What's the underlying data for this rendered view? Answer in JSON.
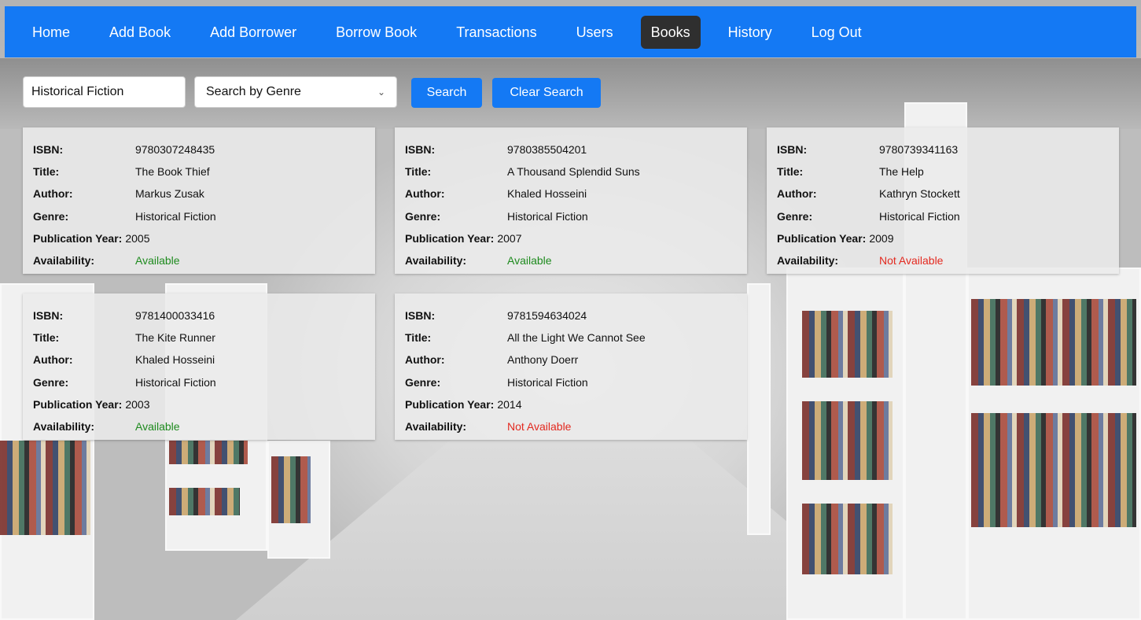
{
  "nav": {
    "items": [
      {
        "label": "Home",
        "active": false
      },
      {
        "label": "Add Book",
        "active": false
      },
      {
        "label": "Add Borrower",
        "active": false
      },
      {
        "label": "Borrow Book",
        "active": false
      },
      {
        "label": "Transactions",
        "active": false
      },
      {
        "label": "Users",
        "active": false
      },
      {
        "label": "Books",
        "active": true
      },
      {
        "label": "History",
        "active": false
      },
      {
        "label": "Log Out",
        "active": false
      }
    ]
  },
  "search": {
    "query": "Historical Fiction",
    "filter_selected": "Search by Genre",
    "search_label": "Search",
    "clear_label": "Clear Search"
  },
  "labels": {
    "isbn": "ISBN:",
    "title": "Title:",
    "author": "Author:",
    "genre": "Genre:",
    "year": "Publication Year:",
    "availability": "Availability:"
  },
  "books": [
    {
      "isbn": "9780307248435",
      "title": "The Book Thief",
      "author": "Markus Zusak",
      "genre": "Historical Fiction",
      "year": "2005",
      "availability": "Available"
    },
    {
      "isbn": "9780385504201",
      "title": "A Thousand Splendid Suns",
      "author": "Khaled Hosseini",
      "genre": "Historical Fiction",
      "year": "2007",
      "availability": "Available"
    },
    {
      "isbn": "9780739341163",
      "title": "The Help",
      "author": "Kathryn Stockett",
      "genre": "Historical Fiction",
      "year": "2009",
      "availability": "Not Available"
    },
    {
      "isbn": "9781400033416",
      "title": "The Kite Runner",
      "author": "Khaled Hosseini",
      "genre": "Historical Fiction",
      "year": "2003",
      "availability": "Available"
    },
    {
      "isbn": "9781594634024",
      "title": "All the Light We Cannot See",
      "author": "Anthony Doerr",
      "genre": "Historical Fiction",
      "year": "2014",
      "availability": "Not Available"
    }
  ],
  "colors": {
    "nav_bg": "#1479f4",
    "nav_active_bg": "#2f2f2f",
    "available": "#1d8a1d",
    "not_available": "#e3291f"
  }
}
